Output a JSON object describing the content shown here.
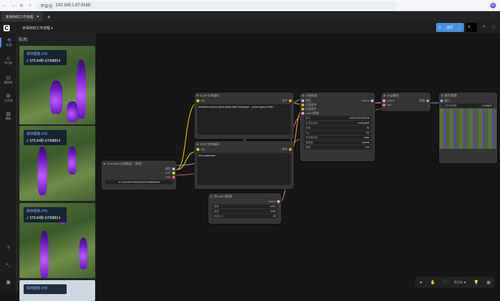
{
  "browser": {
    "url": "192.168.1.87:8188",
    "insecure_label": "不安全",
    "avatar": "G"
  },
  "tab": {
    "title": "未保存的工作流程",
    "new": "+"
  },
  "toolbar": {
    "workflow_name": "未保存的工作流程 ▾",
    "run_label": "运行",
    "batch_count": "1"
  },
  "sidebar": {
    "items": [
      {
        "icon": "⟲",
        "label": "队列"
      },
      {
        "icon": "◇",
        "label": "节点库"
      },
      {
        "icon": "⊡",
        "label": "模型库"
      },
      {
        "icon": "⊞",
        "label": "工作流"
      },
      {
        "icon": "▤",
        "label": "模板"
      }
    ],
    "bottom": [
      "?",
      ">_",
      "▣"
    ]
  },
  "queue": {
    "title": "队列",
    "items": [
      {
        "title": "保存图像 (#9)",
        "time": "✓ 376.64秒 b7058814"
      },
      {
        "title": "保存图像 (#9)",
        "time": "✓ 376.64秒 b7058814"
      },
      {
        "title": "保存图像 (#9)",
        "time": "✓ 376.64秒 b7058814"
      },
      {
        "title": "保存图像 (#9)",
        "time": ""
      }
    ]
  },
  "nodes": {
    "clip1": {
      "title": "CLIP文本编码",
      "in": "clip",
      "out": "条件",
      "text": "beautiful scenery nature glass bottle landscape, , purple galaxy bottle,"
    },
    "clip2": {
      "title": "CLIP文本编码",
      "in": "clip",
      "out": "条件",
      "text": "text, watermark"
    },
    "checkpoint": {
      "title": "Checkpoint加载器（简易）",
      "outs": [
        "模型",
        "CLIP",
        "VAE"
      ],
      "ckpt": "v1-5-pruned-emaonly-fp16.safetensors"
    },
    "latent": {
      "title": "空Latent图像",
      "out": "Latent",
      "widgets": [
        {
          "label": "宽度",
          "value": "1024"
        },
        {
          "label": "高度",
          "value": "1024"
        },
        {
          "label": "批量大小",
          "value": "28"
        }
      ]
    },
    "ksampler": {
      "title": "K采样器",
      "ins": [
        "模型",
        "正面条件",
        "负面条件",
        "Latent图像"
      ],
      "out": "Latent",
      "widgets": [
        {
          "label": "种子",
          "value": "243197734752215"
        },
        {
          "label": "生成后控制",
          "value": "randomize"
        },
        {
          "label": "步数",
          "value": "50"
        },
        {
          "label": "cfg",
          "value": "8.0"
        },
        {
          "label": "采样器名称",
          "value": "euler"
        },
        {
          "label": "调度器",
          "value": "normal"
        },
        {
          "label": "降噪",
          "value": "1.00"
        }
      ]
    },
    "vae": {
      "title": "VAE解码",
      "ins": [
        "Latent",
        "vae"
      ],
      "out": "图像"
    },
    "save": {
      "title": "保存图像",
      "in": "图片",
      "prefix_label": "文件名前缀",
      "prefix": "ComfyUI"
    }
  },
  "canvas": {
    "zoom": "91% ▾"
  }
}
